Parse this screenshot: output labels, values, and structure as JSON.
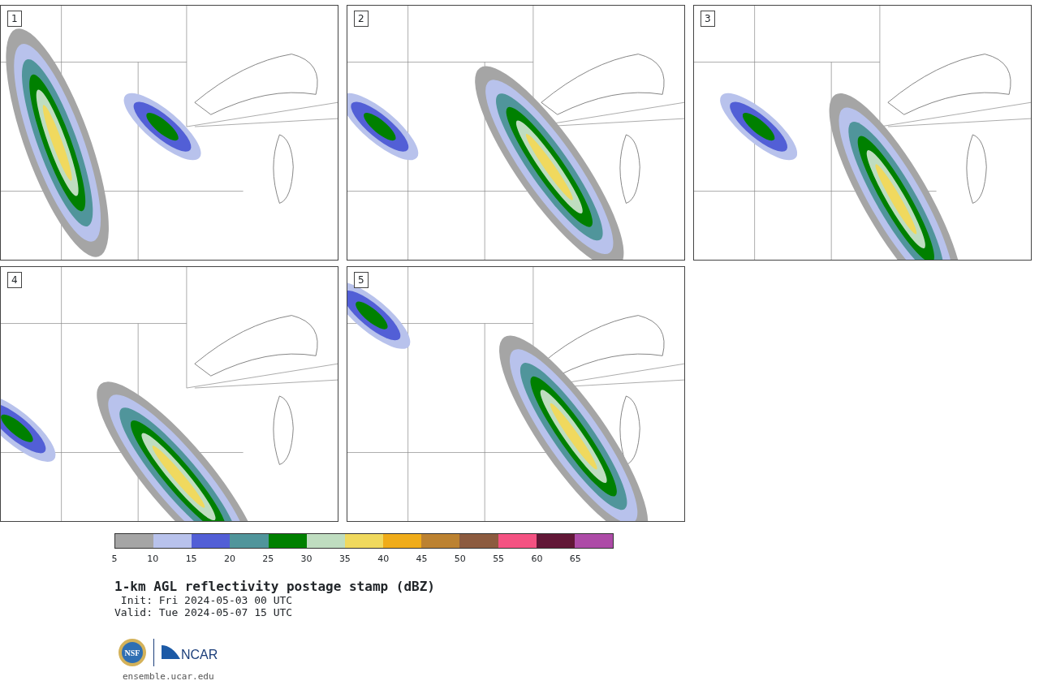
{
  "panels": [
    {
      "label": "1"
    },
    {
      "label": "2"
    },
    {
      "label": "3"
    },
    {
      "label": "4"
    },
    {
      "label": "5"
    }
  ],
  "colorbar": {
    "bins": [
      {
        "color": "#a5a5a5"
      },
      {
        "color": "#b8c2ec"
      },
      {
        "color": "#525fd6"
      },
      {
        "color": "#50959b"
      },
      {
        "color": "#008000"
      },
      {
        "color": "#bfddc0"
      },
      {
        "color": "#f0d95e"
      },
      {
        "color": "#f0ac19"
      },
      {
        "color": "#bc8231"
      },
      {
        "color": "#8c5b3f"
      },
      {
        "color": "#f45282"
      },
      {
        "color": "#621737"
      },
      {
        "color": "#ad4ba7"
      }
    ],
    "ticks": [
      "5",
      "10",
      "15",
      "20",
      "25",
      "30",
      "35",
      "40",
      "45",
      "50",
      "55",
      "60",
      "65"
    ]
  },
  "title": "1-km AGL reflectivity postage stamp (dBZ)",
  "init": " Init: Fri 2024-05-03 00 UTC",
  "valid": "Valid: Tue 2024-05-07 15 UTC",
  "logos": {
    "nsf": "NSF",
    "ncar": "NCAR"
  },
  "url": "ensemble.ucar.edu"
}
